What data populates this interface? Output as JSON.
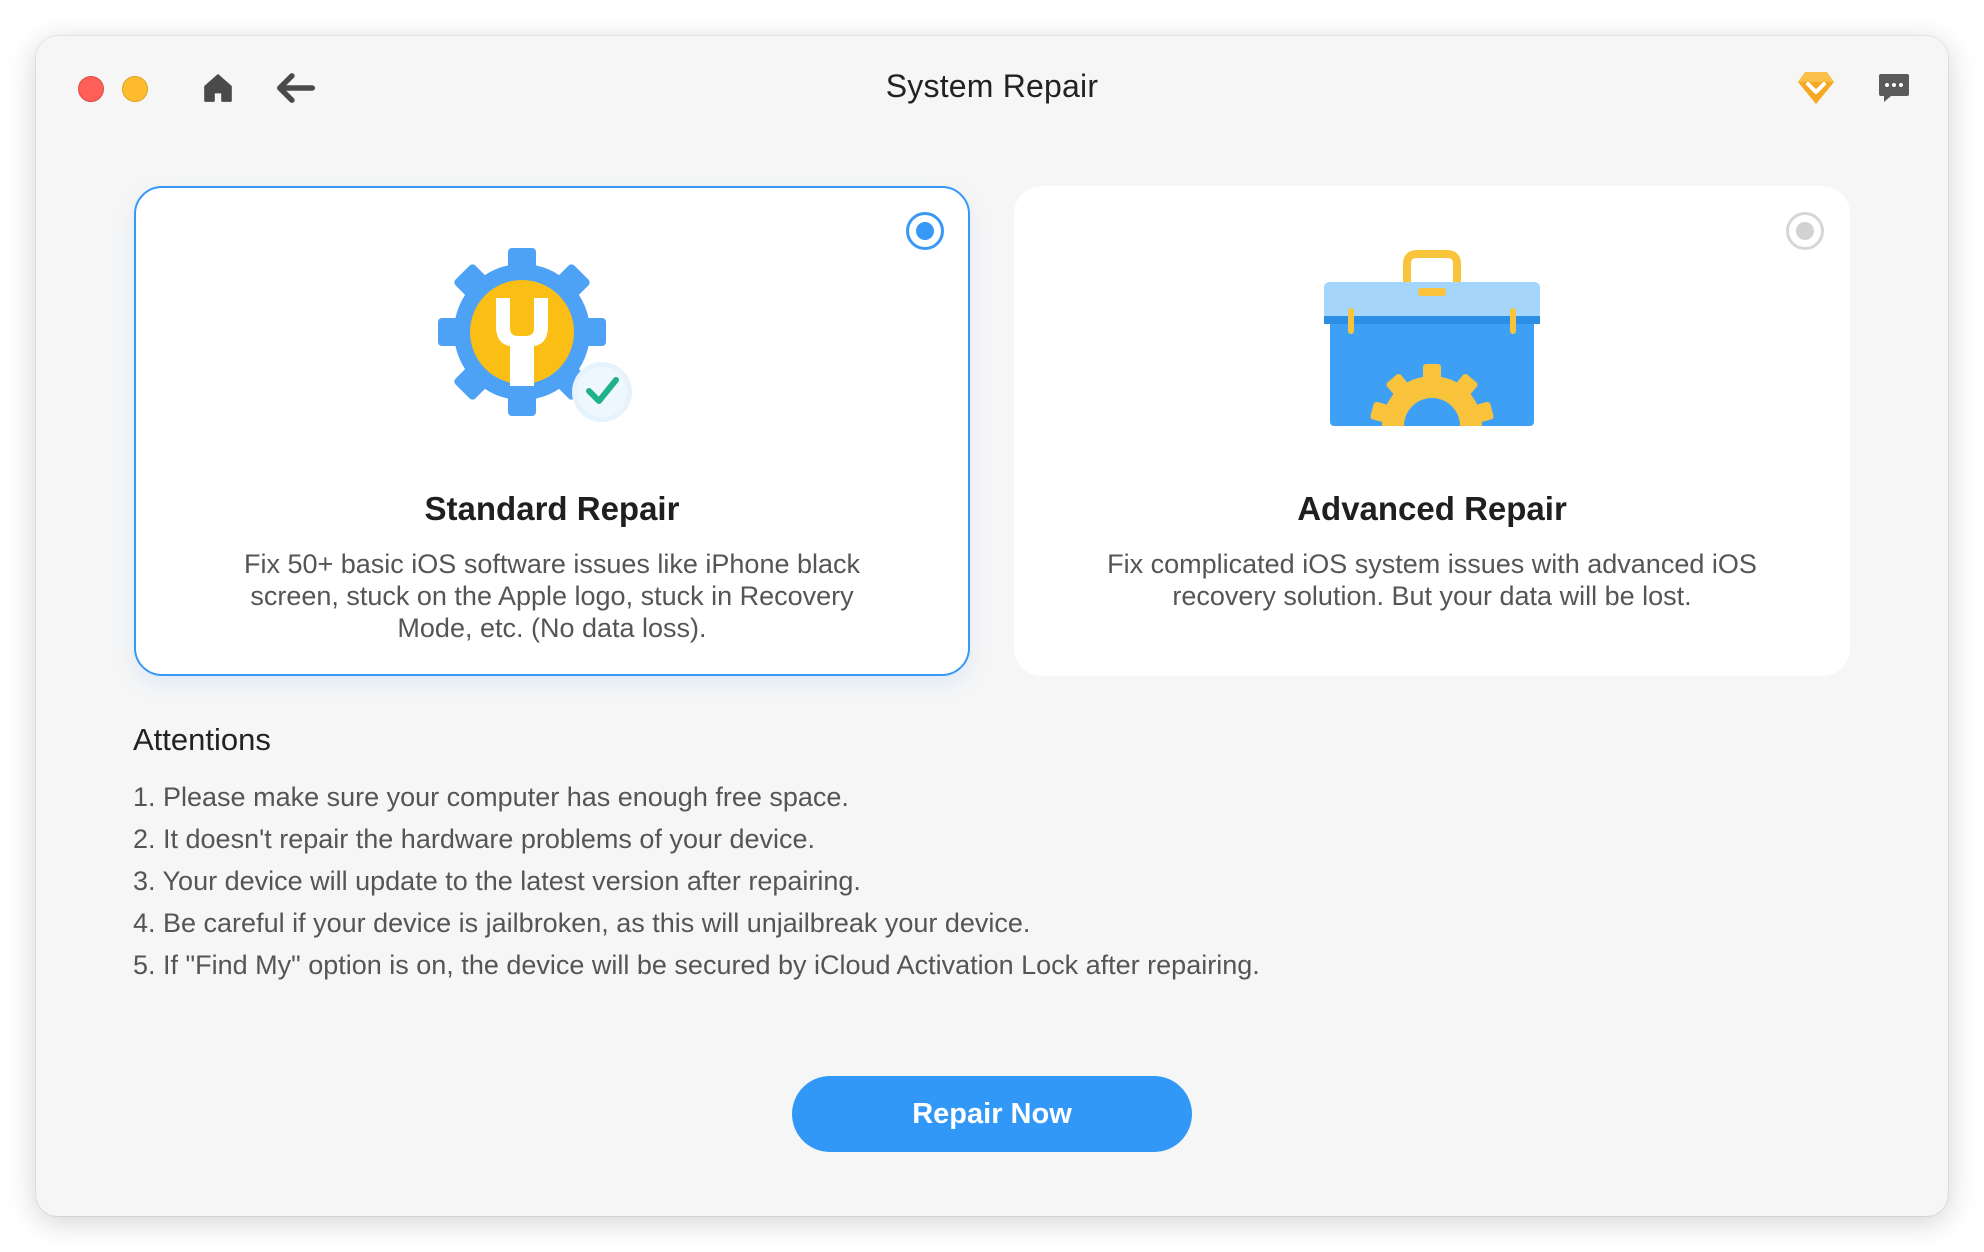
{
  "window": {
    "title": "System Repair"
  },
  "toolbar": {
    "icons": [
      "close-dot",
      "minimize-dot",
      "home-icon",
      "back-arrow-icon",
      "premium-diamond-icon",
      "message-icon"
    ]
  },
  "modes": [
    {
      "title": "Standard Repair",
      "description": "Fix 50+ basic iOS software issues like iPhone black screen, stuck on the Apple logo, stuck in Recovery Mode, etc. (No data loss).",
      "selected": true,
      "icon": "gear-wrench-check-icon"
    },
    {
      "title": "Advanced Repair",
      "description": "Fix complicated iOS system issues with advanced iOS recovery solution. But your data will be lost.",
      "selected": false,
      "icon": "toolbox-gear-icon"
    }
  ],
  "attentions": {
    "title": "Attentions",
    "items": [
      "1. Please make sure your computer has enough free space.",
      "2. It doesn't repair the hardware problems of your device.",
      "3. Your device will update to the latest version after repairing.",
      "4. Be careful if your device is jailbroken, as this will unjailbreak your device.",
      "5. If \"Find My\" option is on, the device will be secured by iCloud Activation Lock after repairing."
    ]
  },
  "action": {
    "repair_label": "Repair Now"
  },
  "colors": {
    "accent": "#3298f8",
    "close": "#fe5f57",
    "minimize": "#febc2e",
    "premium": "#f5a623"
  }
}
